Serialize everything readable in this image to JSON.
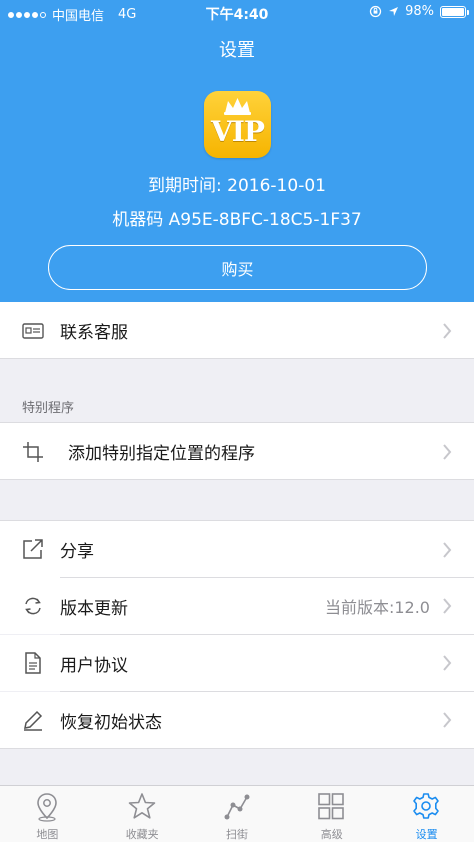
{
  "status_bar": {
    "carrier": "中国电信",
    "network": "4G",
    "time": "下午4:40",
    "battery": "98%",
    "battery_level": 0.98
  },
  "header": {
    "title": "设置",
    "logo_text": "VIP",
    "expiry": "到期时间: 2016-10-01",
    "machine_code": "机器码 A95E-8BFC-18C5-1F37",
    "buy_label": "购买"
  },
  "contact": {
    "label": "联系客服"
  },
  "special_section": {
    "header": "特别程序",
    "item_label": "添加特别指定位置的程序"
  },
  "settings_list": {
    "share_label": "分享",
    "update_label": "版本更新",
    "update_value": "当前版本:12.0",
    "agreement_label": "用户协议",
    "reset_label": "恢复初始状态"
  },
  "tabs": [
    {
      "label": "地图",
      "icon": "map-pin-icon"
    },
    {
      "label": "收藏夹",
      "icon": "star-icon"
    },
    {
      "label": "扫街",
      "icon": "route-icon"
    },
    {
      "label": "高级",
      "icon": "grid-icon"
    },
    {
      "label": "设置",
      "icon": "gear-icon",
      "active": true
    }
  ],
  "colors": {
    "header_blue": "#3d9ff0",
    "active_tab": "#1a8cf0",
    "vip_gold": "#f6b400"
  }
}
